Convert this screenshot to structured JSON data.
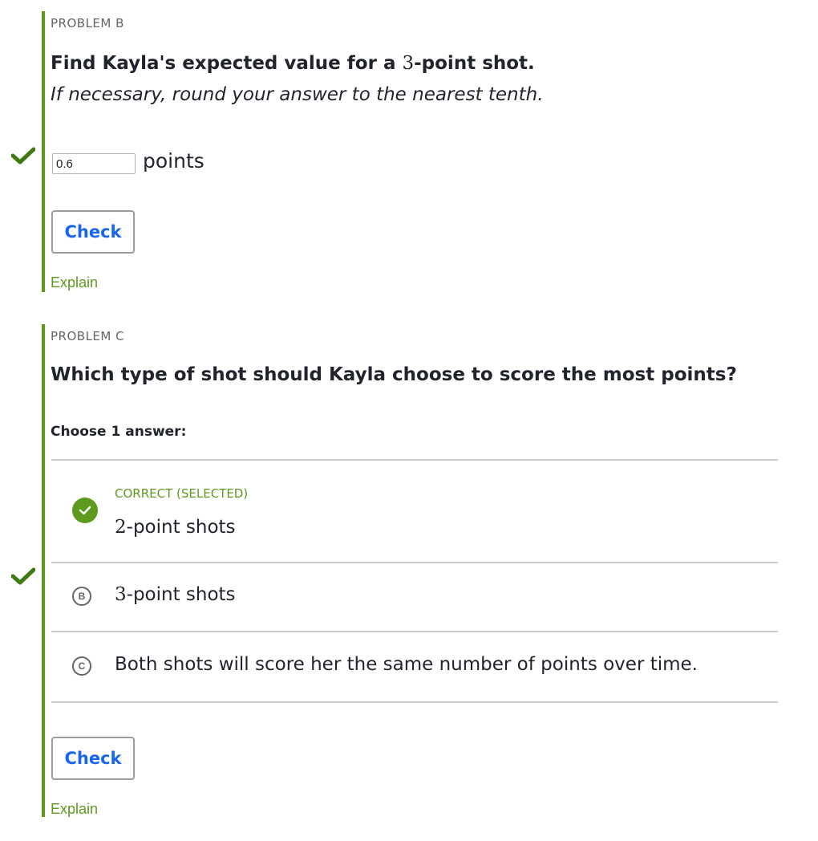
{
  "problem_b": {
    "label": "PROBLEM B",
    "question_prefix": "Find Kayla's expected value for a ",
    "question_math": "3",
    "question_suffix": "-point shot.",
    "hint": "If necessary, round your answer to the nearest tenth.",
    "answer_value": "0.6",
    "unit": "points",
    "check_label": "Check",
    "explain_label": "Explain",
    "status": "correct"
  },
  "problem_c": {
    "label": "PROBLEM C",
    "question": "Which type of shot should Kayla choose to score the most points?",
    "choose_label": "Choose 1 answer:",
    "choices": [
      {
        "letter": "A",
        "status": "CORRECT (SELECTED)",
        "math": "2",
        "text": "-point shots"
      },
      {
        "letter": "B",
        "math": "3",
        "text": "-point shots"
      },
      {
        "letter": "C",
        "text": "Both shots will score her the same number of points over time."
      }
    ],
    "check_label": "Check",
    "explain_label": "Explain",
    "status": "correct"
  },
  "colors": {
    "accent_green": "#5d9a1e",
    "check_green": "#3e7a12",
    "link_blue": "#1865f2"
  },
  "icons": {
    "status_check": "checkmark-icon",
    "correct_choice": "check-circle-icon"
  }
}
